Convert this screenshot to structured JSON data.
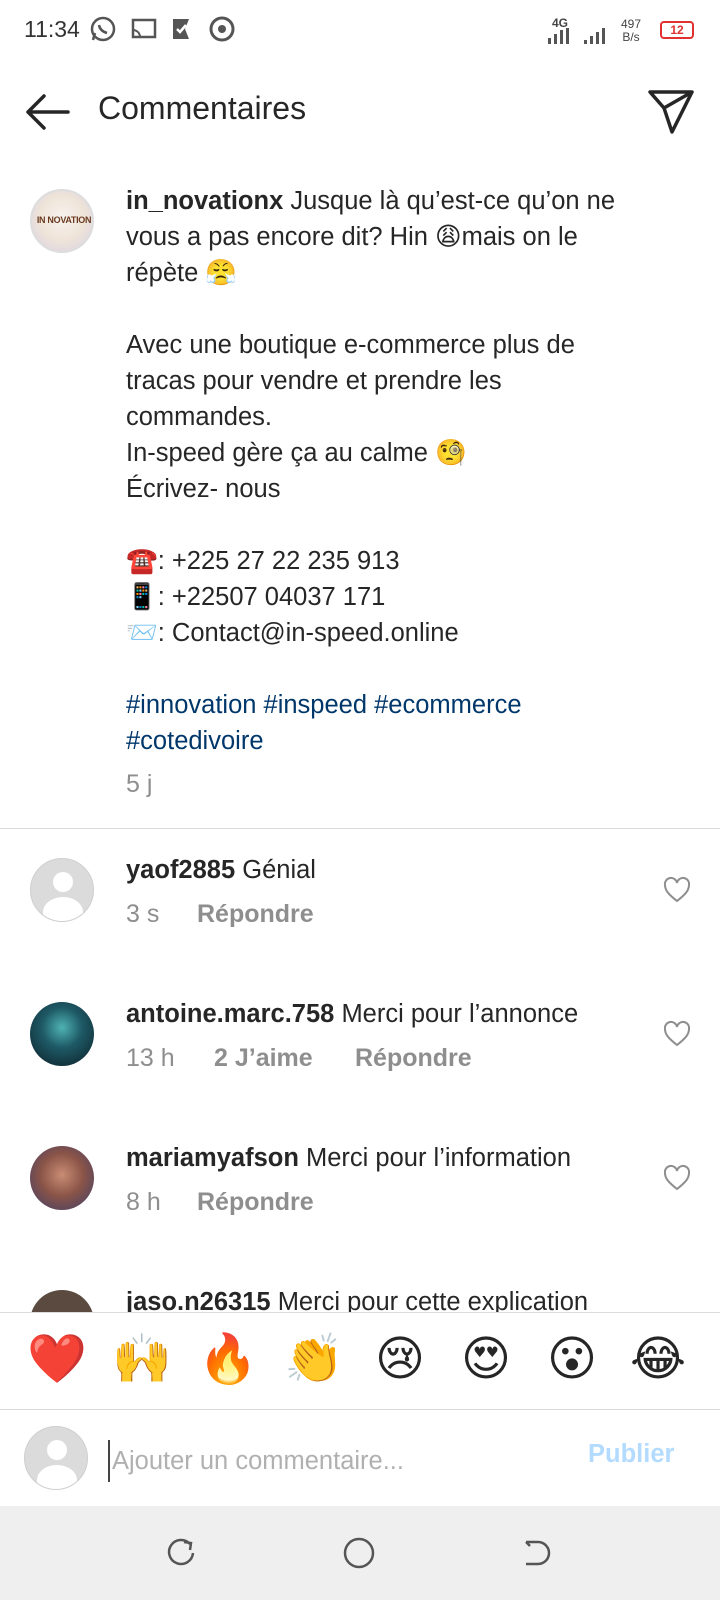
{
  "status_bar": {
    "time": "11:34",
    "network": "4G",
    "speed_value": "497",
    "speed_unit": "B/s",
    "battery": "12"
  },
  "header": {
    "title": "Commentaires"
  },
  "caption": {
    "username": "in_novationx",
    "avatar_text": "IN NOVATION",
    "text": " Jusque là qu’est-ce qu’on ne vous a pas encore dit? Hin 😩mais on le répète 😤\n\nAvec une boutique e-commerce plus de tracas pour vendre et prendre les commandes.\nIn-speed gère ça au calme 🧐\nÉcrivez- nous\n\n☎️: +225 27 22 235 913\n📱: +22507 04037 171\n📨: Contact@in-speed.online\n\n",
    "hashtags": "#innovation #inspeed #ecommerce #cotedivoire",
    "time": "5 j"
  },
  "comments": [
    {
      "username": "yaof2885",
      "text": " Génial",
      "time": "3 s",
      "likes": "",
      "reply": "Répondre"
    },
    {
      "username": "antoine.marc.758",
      "text": " Merci pour l’annonce",
      "time": "13 h",
      "likes": "2 J’aime",
      "reply": "Répondre"
    },
    {
      "username": "mariamyafson",
      "text": " Merci pour l’information",
      "time": "8 h",
      "likes": "",
      "reply": "Répondre"
    },
    {
      "username": "jaso.n26315",
      "text": " Merci pour cette explication"
    }
  ],
  "emoji_bar": [
    "❤️",
    "🙌",
    "🔥",
    "👏",
    "😢",
    "😍",
    "😮",
    "😂"
  ],
  "input": {
    "placeholder": "Ajouter un commentaire...",
    "publish": "Publier"
  },
  "colors": {
    "hashtag": "#00376b",
    "publish_disabled": "#b3dbff",
    "meta_gray": "#8e8e8e",
    "battery_low": "#e03030"
  }
}
